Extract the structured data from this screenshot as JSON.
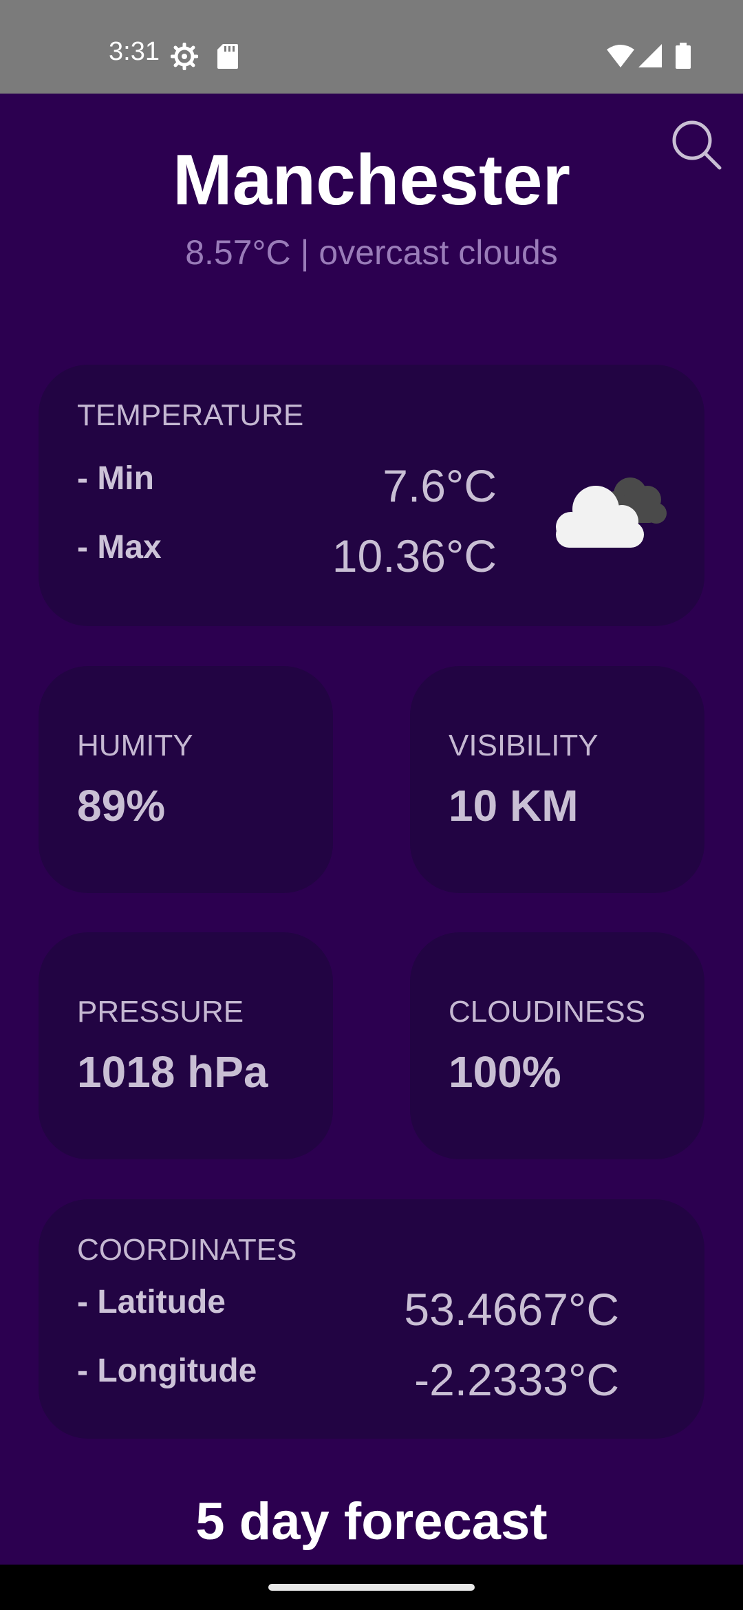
{
  "status_bar": {
    "time": "3:31",
    "icons": [
      "settings-gear-icon",
      "sd-card-icon",
      "wifi-icon",
      "cell-signal-icon",
      "battery-icon"
    ]
  },
  "header": {
    "search_icon": "search-icon",
    "city": "Manchester",
    "summary": "8.57°C | overcast clouds"
  },
  "temperature": {
    "title": "TEMPERATURE",
    "min_label": "- Min",
    "min_value": "7.6°C",
    "max_label": "- Max",
    "max_value": "10.36°C",
    "icon": "overcast-clouds-icon"
  },
  "humidity": {
    "title": "HUMITY",
    "value": "89%"
  },
  "visibility": {
    "title": "VISIBILITY",
    "value": "10 KM"
  },
  "pressure": {
    "title": "PRESSURE",
    "value": "1018 hPa"
  },
  "cloudiness": {
    "title": "CLOUDINESS",
    "value": "100%"
  },
  "coordinates": {
    "title": "COORDINATES",
    "lat_label": "- Latitude",
    "lat_value": "53.4667°C",
    "lon_label": "- Longitude",
    "lon_value": "-2.2333°C"
  },
  "forecast": {
    "title": "5 day forecast"
  },
  "colors": {
    "background": "#2c0050",
    "card": "#220443",
    "status_bar": "#7b7b7b",
    "summary_text": "#9a7cb9"
  }
}
